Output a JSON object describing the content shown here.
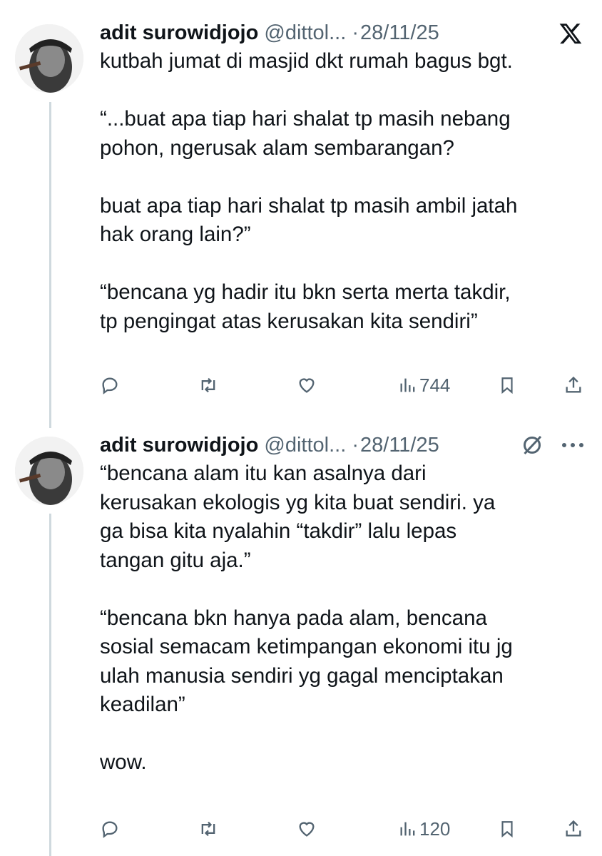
{
  "tweets": [
    {
      "author": {
        "name": "adit surowidjojo",
        "handle": "@dittol...",
        "separator": "·"
      },
      "date": "28/11/25",
      "text": "kutbah jumat di masjid dkt rumah bagus bgt.\n\n“...buat apa tiap hari shalat tp masih nebang\npohon, ngerusak alam sembarangan?\n\nbuat apa tiap hari shalat tp masih ambil jatah\nhak orang lain?”\n\n“bencana yg hadir itu bkn serta merta takdir,\ntp pengingat atas kerusakan kita sendiri”",
      "views": "744",
      "top_right_icon": "x-logo-icon"
    },
    {
      "author": {
        "name": "adit surowidjojo",
        "handle": "@dittol...",
        "separator": "·"
      },
      "date": "28/11/25",
      "text": "“bencana alam itu kan asalnya dari\nkerusakan ekologis yg kita buat sendiri. ya\nga bisa kita nyalahin “takdir” lalu lepas\ntangan gitu aja.”\n\n“bencana bkn hanya pada alam, bencana\nsosial semacam ketimpangan ekonomi itu jg\nulah manusia sendiri yg gagal menciptakan\nkeadilan”\n\nwow.",
      "views": "120",
      "top_right_icon": "grok-icon"
    }
  ],
  "colors": {
    "text": "#0f1419",
    "muted": "#536471",
    "thread_line": "#cfd9de"
  }
}
